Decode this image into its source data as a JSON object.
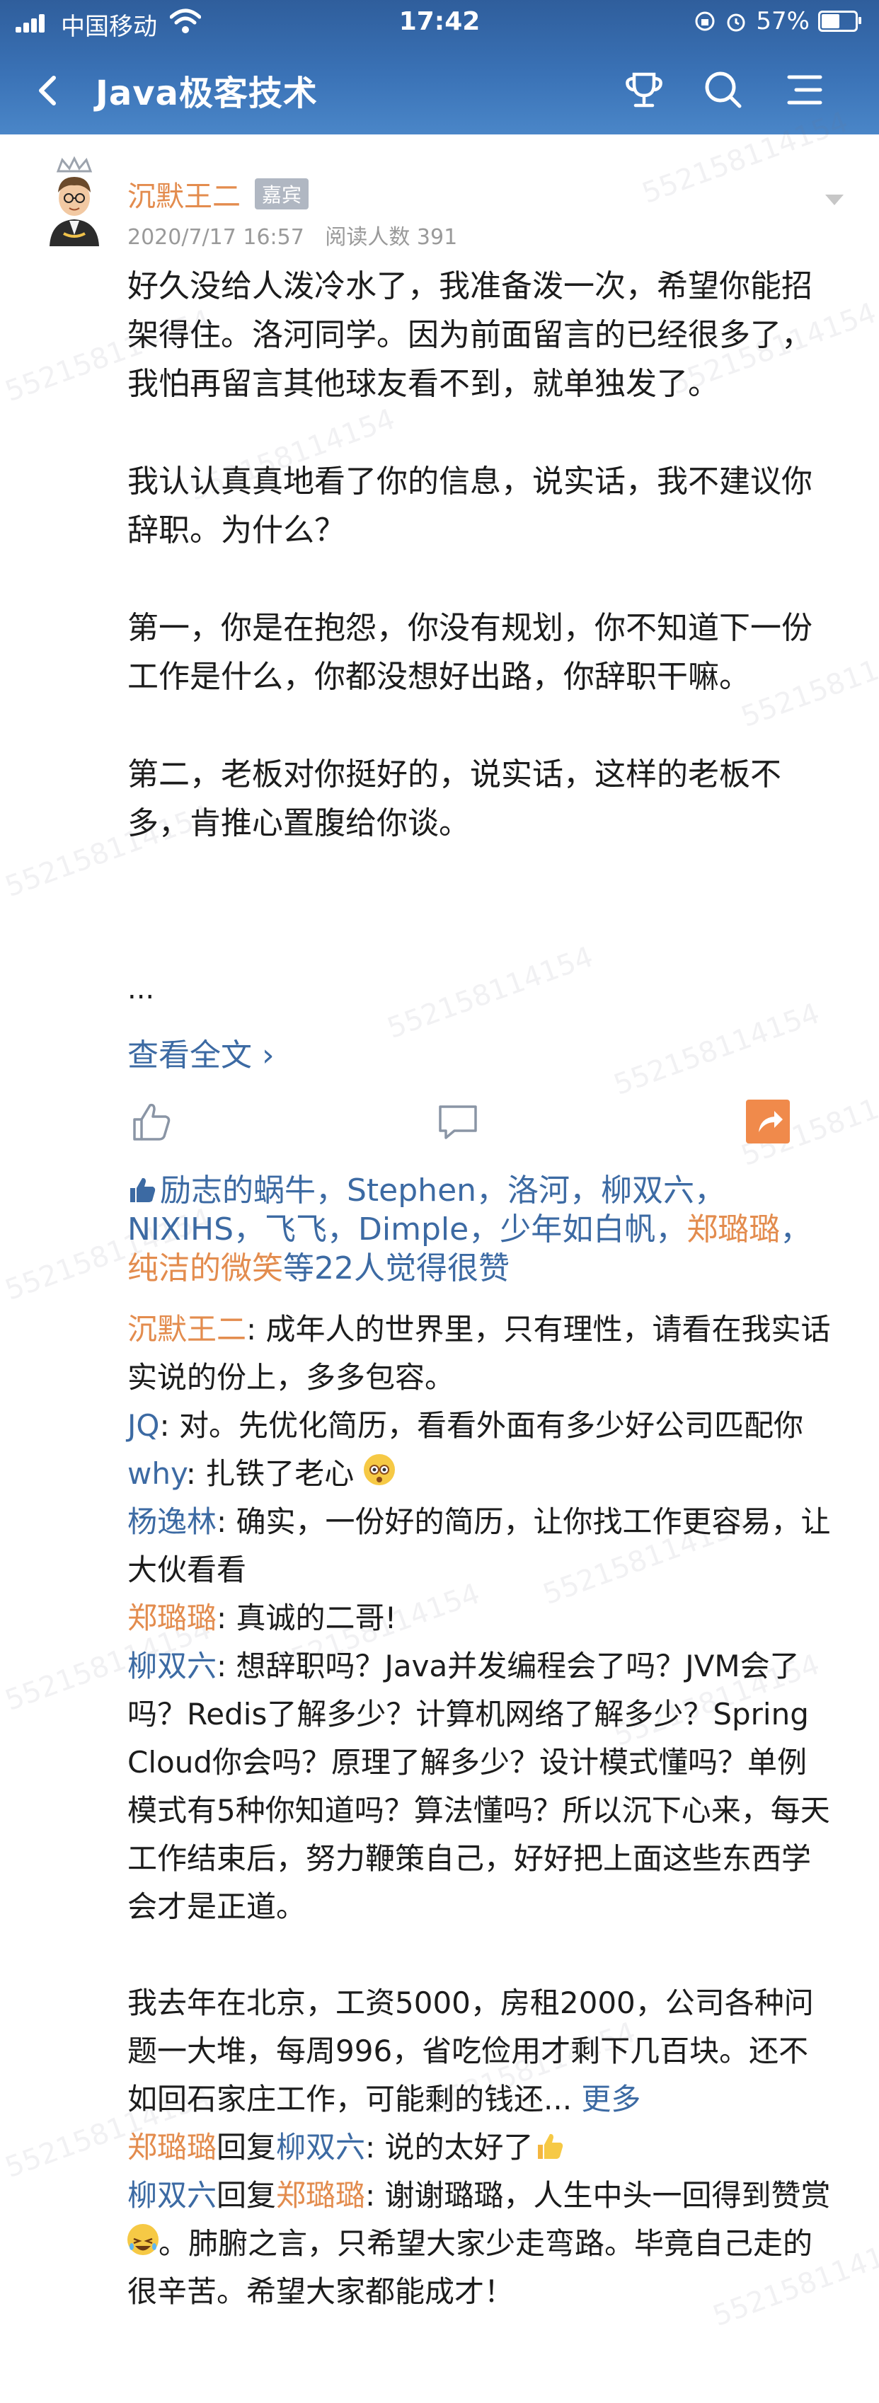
{
  "status": {
    "carrier": "中国移动",
    "time": "17:42",
    "battery": "57%",
    "battery_level": 0.57
  },
  "nav": {
    "title": "Java极客技术"
  },
  "post": {
    "author": "沉默王二",
    "badge": "嘉宾",
    "date": "2020/7/17 16:57",
    "read_count": "阅读人数 391",
    "paragraphs": [
      "好久没给人泼冷水了，我准备泼一次，希望你能招架得住。洛河同学。因为前面留言的已经很多了，我怕再留言其他球友看不到，就单独发了。",
      "我认认真真地看了你的信息，说实话，我不建议你辞职。为什么？",
      "第一，你是在抱怨，你没有规划，你不知道下一份工作是什么，你都没想好出路，你辞职干嘛。",
      "第二，老板对你挺好的，说实话，这样的老板不多，肯推心置腹给你谈。"
    ],
    "ellipsis": "...",
    "view_all": "查看全文 ›"
  },
  "likes": {
    "names_blue": [
      "励志的蜗牛",
      "Stephen",
      "洛河",
      "柳双六",
      "NIXIHS",
      "飞飞",
      "Dimple",
      "少年如白帆"
    ],
    "names_orange": [
      "郑璐璐",
      "纯洁的微笑"
    ],
    "suffix": "等22人觉得很赞"
  },
  "comments": [
    {
      "author": "沉默王二",
      "author_color": "orange",
      "text": ": 成年人的世界里，只有理性，请看在我实话实说的份上，多多包容。"
    },
    {
      "author": "JQ",
      "author_color": "blue",
      "text": ": 对。先优化简历，看看外面有多少好公司匹配你"
    },
    {
      "author": "why",
      "author_color": "blue",
      "text": ": 扎铁了老心 "
    },
    {
      "author": "杨逸林",
      "author_color": "blue",
      "text": ": 确实，一份好的简历，让你找工作更容易，让大伙看看"
    },
    {
      "author": "郑璐璐",
      "author_color": "orange",
      "text": ": 真诚的二哥!"
    },
    {
      "author": "柳双六",
      "author_color": "blue",
      "text": ": 想辞职吗？Java并发编程会了吗？JVM会了吗？Redis了解多少？计算机网络了解多少？Spring Cloud你会吗？原理了解多少？设计模式懂吗？单例模式有5种你知道吗？算法懂吗？所以沉下心来，每天工作结束后，努力鞭策自己，好好把上面这些东西学会才是正道。"
    },
    {
      "author": "",
      "author_color": "blue",
      "text": "我去年在北京，工资5000，房租2000，公司各种问题一大堆，每周996，省吃俭用才剩下几百块。还不如回石家庄工作，可能剩的钱还..."
    },
    {
      "author": "郑璐璐",
      "author_color": "orange",
      "reply_word": "回复",
      "reply_to": "柳双六",
      "text": ": 说的太好了"
    },
    {
      "author": "柳双六",
      "author_color": "blue",
      "reply_word": "回复",
      "reply_to": "郑璐璐",
      "text": ": 谢谢璐璐，人生中头一回得到赞赏"
    },
    {
      "author": "",
      "author_color": "blue",
      "text": "。肺腑之言，只希望大家少走弯路。毕竟自己走的很辛苦。希望大家都能成才！"
    }
  ],
  "more_label": "更多",
  "watermark": "552158114154",
  "colors": {
    "header": "#3a72b6",
    "name_orange": "#e38c4e",
    "name_blue": "#3c6aa3",
    "share": "#f08a4b"
  },
  "icons": [
    "back-icon",
    "trophy-icon",
    "search-icon",
    "menu-icon",
    "like-icon",
    "comment-icon",
    "share-icon",
    "thumbs-up-icon",
    "dizzy-face-emoji",
    "thumbs-up-emoji",
    "laughing-emoji"
  ]
}
